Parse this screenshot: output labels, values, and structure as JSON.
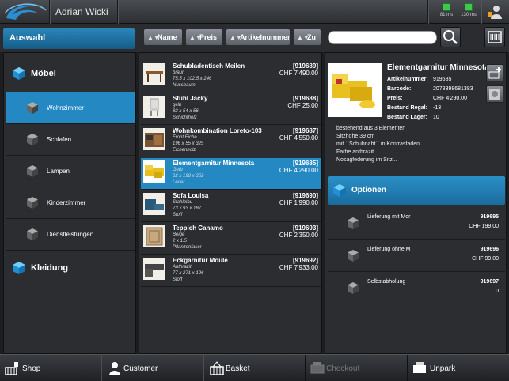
{
  "user": {
    "name": "Adrian Wicki"
  },
  "status": {
    "signal1": "81 ms",
    "signal2": "130 ms"
  },
  "selection_tab": "Auswahl",
  "sort_buttons": [
    {
      "label": "Name"
    },
    {
      "label": "Preis"
    },
    {
      "label": "Artikelnummer"
    },
    {
      "label": "Zu"
    }
  ],
  "search": {
    "value": "",
    "placeholder": ""
  },
  "categories": [
    {
      "label": "Möbel",
      "subcategories": [
        "Wohnzimmer",
        "Schlafen",
        "Lampen",
        "Kinderzimmer",
        "Dienstleistungen"
      ]
    },
    {
      "label": "Kleidung"
    }
  ],
  "active_subcategory": "Wohnzimmer",
  "products": [
    {
      "name": "Schubladentisch Meilen",
      "id": "[919689]",
      "price": "CHF 7'490.00",
      "lines": [
        "braun",
        "75.5 x 102.5 x 246",
        "Nussbaum"
      ]
    },
    {
      "name": "Stuhl Jacky",
      "id": "[919688]",
      "price": "CHF 25.00",
      "lines": [
        "gelb",
        "82 x 54 x 56",
        "Schichtholz"
      ]
    },
    {
      "name": "Wohnkombination Loreto-103",
      "id": "[919687]",
      "price": "CHF 4'550.00",
      "lines": [
        "Front Eiche",
        "196 x 55 x 325",
        "Eichenholz"
      ]
    },
    {
      "name": "Elementgarnitur Minnesota",
      "id": "[919685]",
      "price": "CHF 4'290.00",
      "lines": [
        "Gelb",
        "62 x 198 x 352",
        "Leder"
      ]
    },
    {
      "name": "Sofa Louisa",
      "id": "[919690]",
      "price": "CHF 1'990.00",
      "lines": [
        "Stahlblau",
        "73 x 93 x 187",
        "Stoff"
      ]
    },
    {
      "name": "Teppich Canamo",
      "id": "[919693]",
      "price": "CHF 2'350.00",
      "lines": [
        "Beige",
        "2 x 1.5",
        "Pflanzenfaser"
      ]
    },
    {
      "name": "Eckgarnitur Moule",
      "id": "[919692]",
      "price": "CHF 7'933.00",
      "lines": [
        "Anthrazit",
        "77 x 271 x 196",
        "Stoff"
      ]
    }
  ],
  "detail": {
    "name": "Elementgarnitur Minnesota",
    "rows": [
      {
        "label": "Artikelnummer:",
        "value": "919685"
      },
      {
        "label": "Barcode:",
        "value": "2078398681383"
      },
      {
        "label": "Preis:",
        "value": "CHF 4'290.00"
      },
      {
        "label": "Bestand Regal:",
        "value": "-13"
      },
      {
        "label": "Bestand Lager:",
        "value": "10"
      }
    ],
    "description": [
      "bestehend aus 3 Elementen",
      "Sitzhöhe 39 cm",
      "mit ``Schuhnaht`` in Kontrasfaden",
      "Farbe anthrazit",
      "Nosagfederung im Sitz..."
    ]
  },
  "options_title": "Optionen",
  "options": [
    {
      "name": "Lieferung mit Mor",
      "id": "919695",
      "price": "CHF 199.00"
    },
    {
      "name": "Lieferung ohne M",
      "id": "919696",
      "price": "CHF 99.00"
    },
    {
      "name": "Selbstabholung",
      "id": "919697",
      "price": "0"
    }
  ],
  "bottom_nav": [
    {
      "label": "Shop",
      "icon": "shop-icon",
      "enabled": true
    },
    {
      "label": "Customer",
      "icon": "person-icon",
      "enabled": true
    },
    {
      "label": "Basket",
      "icon": "basket-icon",
      "enabled": true
    },
    {
      "label": "Checkout",
      "icon": "checkout-icon",
      "enabled": false
    },
    {
      "label": "Unpark",
      "icon": "unpark-icon",
      "enabled": true
    }
  ],
  "colors": {
    "accent": "#2489c3",
    "background": "#1b1d20",
    "panel": "#2b2d31"
  }
}
